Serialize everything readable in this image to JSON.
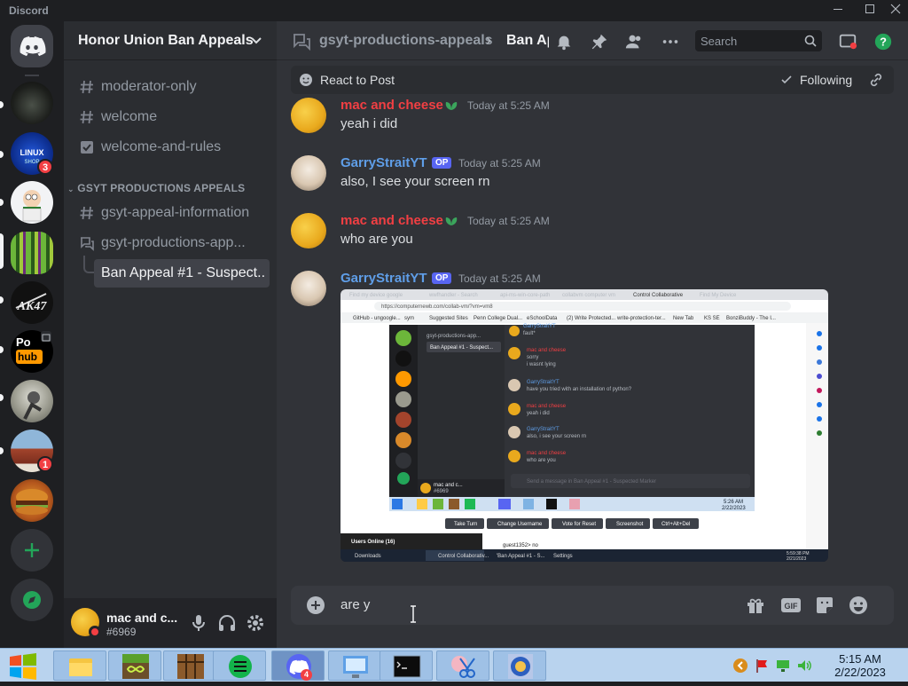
{
  "app": {
    "title": "Discord",
    "window_controls": [
      "minimize",
      "maximize",
      "close"
    ]
  },
  "servers": [
    {
      "name": "dark-server",
      "badge": ""
    },
    {
      "name": "linux-shop",
      "badge": "3"
    },
    {
      "name": "peter-griffin",
      "badge": ""
    },
    {
      "name": "green-stripes",
      "badge": ""
    },
    {
      "name": "ak47",
      "badge": ""
    },
    {
      "name": "pornhub-logo",
      "badge": ""
    },
    {
      "name": "skater",
      "badge": ""
    },
    {
      "name": "building",
      "badge": "1"
    },
    {
      "name": "burger",
      "badge": ""
    }
  ],
  "sidebar": {
    "server_name": "Honor Union Ban Appeals",
    "channels": [
      {
        "label": "moderator-only",
        "icon": "hash-icon"
      },
      {
        "label": "welcome",
        "icon": "hash-icon"
      },
      {
        "label": "welcome-and-rules",
        "icon": "rules-icon"
      }
    ],
    "category": "GSYT PRODUCTIONS APPEALS",
    "category_channels": [
      {
        "label": "gsyt-appeal-information",
        "icon": "hash-icon"
      },
      {
        "label": "gsyt-productions-app...",
        "icon": "forum-icon"
      },
      {
        "label": "Ban Appeal #1 - Suspect...",
        "icon": "thread-icon",
        "active": true
      }
    ]
  },
  "user": {
    "name": "mac and c...",
    "tag": "#6969"
  },
  "topbar": {
    "channel": "gsyt-productions-appeals",
    "separator": "›",
    "thread": "Ban Ap",
    "search_placeholder": "Search"
  },
  "subbar": {
    "react_label": "React to Post",
    "following_label": "Following"
  },
  "messages": [
    {
      "author": "mac and cheese",
      "time": "Today at 5:25 AM",
      "text": "yeah i did",
      "op": false,
      "color": "#f23f43"
    },
    {
      "author": "GarryStraitYT",
      "op_label": "OP",
      "time": "Today at 5:25 AM",
      "text": "also, I see your screen rn",
      "op": true,
      "color": "#5f9ee8"
    },
    {
      "author": "mac and cheese",
      "time": "Today at 5:25 AM",
      "text": "who are you",
      "op": false,
      "color": "#f23f43"
    },
    {
      "author": "GarryStraitYT",
      "op_label": "OP",
      "time": "Today at 5:25 AM",
      "text": "",
      "op": true,
      "color": "#5f9ee8"
    }
  ],
  "attachment": {
    "url": "https://computernewb.com/collab-vm/?vm=vm8",
    "tabs": [
      "Find my device google",
      "wwfhandler - Search",
      "api-ms-win-core-path",
      "collabvm computer vm",
      "Control Collaborative",
      "Find My Device"
    ],
    "bookmarks": [
      "GitHub - ungoogle...",
      "sym",
      "Suggested Sites",
      "Penn College Dual...",
      "eSchoolData",
      "(2) Write Protected...",
      "write-protection-ter...",
      "New Tab",
      "KS SE",
      "BonziBuddy - The I..."
    ],
    "inner_thread_title": "gsyt-productions-app...",
    "inner_thread_sub": "Ban Appeal #1 - Suspect...",
    "inner_messages": [
      {
        "author": "GarryStraitYT",
        "text": "fault*"
      },
      {
        "author": "mac and cheese",
        "text": "sorry"
      },
      {
        "author": "",
        "text": "i wasnt lying"
      },
      {
        "author": "GarryStraitYT",
        "text": "have you tried with an installation of python?"
      },
      {
        "author": "mac and cheese",
        "text": "yeah i did"
      },
      {
        "author": "GarryStraitYT",
        "text": "also, i see your screen rn"
      },
      {
        "author": "mac and cheese",
        "text": "who are you"
      }
    ],
    "inner_composer": "Send a message in Ban Appeal #1 - Suspected Marker",
    "inner_user": "mac and c...",
    "inner_tag": "#6969",
    "vm_clock": "5:26 AM",
    "vm_date": "2/22/2023",
    "vm_buttons": [
      "Take Turn",
      "Change Username",
      "Vote for Reset",
      "Screenshot",
      "Ctrl+Alt+Del"
    ],
    "users_online": "Users Online (16)",
    "chat_line": "guest1352> no",
    "host_tabs": [
      "Downloads",
      "Control Collaborativ...",
      "'Ban Appeal #1 - S...",
      "Settings"
    ],
    "host_clock": "5:59:38 PM",
    "host_date": "2/21/2023"
  },
  "composer": {
    "value": "are y"
  },
  "taskbar": {
    "time": "5:15 AM",
    "date": "2/22/2023",
    "discord_badge": "4"
  }
}
